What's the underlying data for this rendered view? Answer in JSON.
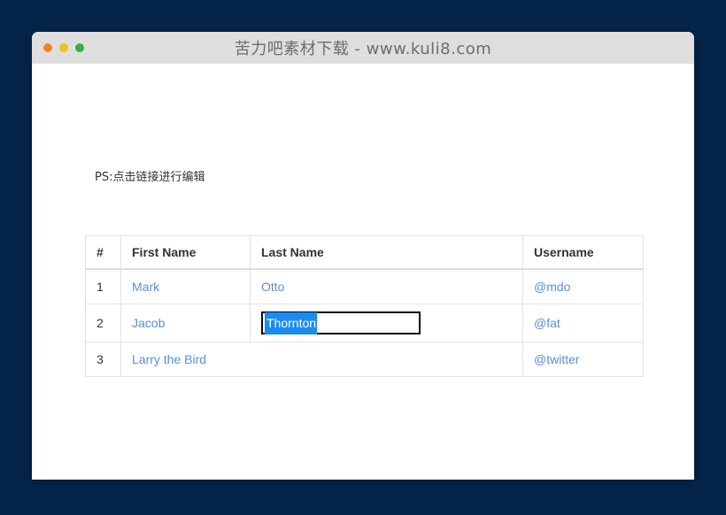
{
  "window": {
    "title": "苦力吧素材下载 - www.kuli8.com",
    "traffic_lights": [
      {
        "name": "close",
        "color": "#f58220"
      },
      {
        "name": "minimize",
        "color": "#f0c419"
      },
      {
        "name": "maximize",
        "color": "#2cb341"
      }
    ]
  },
  "page": {
    "note": "PS:点击链接进行编辑",
    "background": "#ffffff",
    "desktop_background": "#042449",
    "link_color": "#5b8fd6",
    "selection_color": "#1a8cf0"
  },
  "table": {
    "headers": [
      "#",
      "First Name",
      "Last Name",
      "Username"
    ],
    "rows": [
      {
        "num": "1",
        "first_name": "Mark",
        "last_name": "Otto",
        "username": "@mdo",
        "editing": false,
        "span": false
      },
      {
        "num": "2",
        "first_name": "Jacob",
        "last_name": "Thornton",
        "username": "@fat",
        "editing": true,
        "span": false
      },
      {
        "num": "3",
        "first_name": "Larry the Bird",
        "last_name": "",
        "username": "@twitter",
        "editing": false,
        "span": true
      }
    ]
  }
}
